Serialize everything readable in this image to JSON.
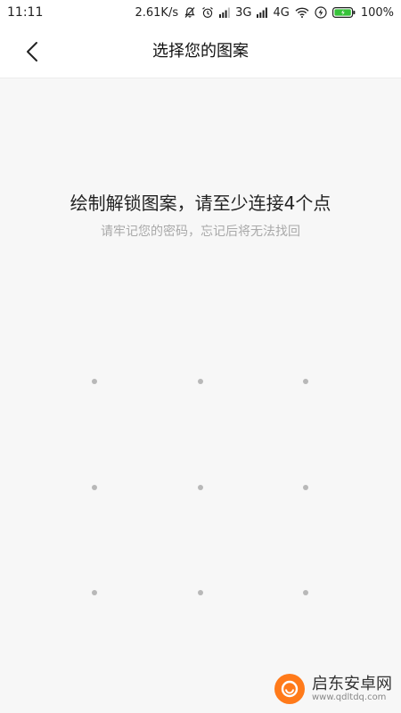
{
  "status_bar": {
    "time": "11:11",
    "speed": "2.61K/s",
    "net_3g": "3G",
    "net_4g": "4G",
    "battery": "100%"
  },
  "header": {
    "title": "选择您的图案"
  },
  "instruction": {
    "main": "绘制解锁图案，请至少连接4个点",
    "sub": "请牢记您的密码，忘记后将无法找回"
  },
  "icons": {
    "back": "chevron-left-icon",
    "mute": "bell-off-icon",
    "alarm": "alarm-icon",
    "signal": "signal-icon",
    "wifi": "wifi-icon",
    "charging": "bolt-icon",
    "battery": "battery-icon"
  },
  "pattern": {
    "rows": 3,
    "cols": 3,
    "dot_color": "#b8b8b8"
  },
  "watermark": {
    "name": "启东安卓网",
    "url": "www.qdltdq.com"
  },
  "colors": {
    "background": "#f7f7f7",
    "bar": "#ffffff",
    "battery_fill": "#37c23a",
    "accent": "#ff7a1a"
  }
}
